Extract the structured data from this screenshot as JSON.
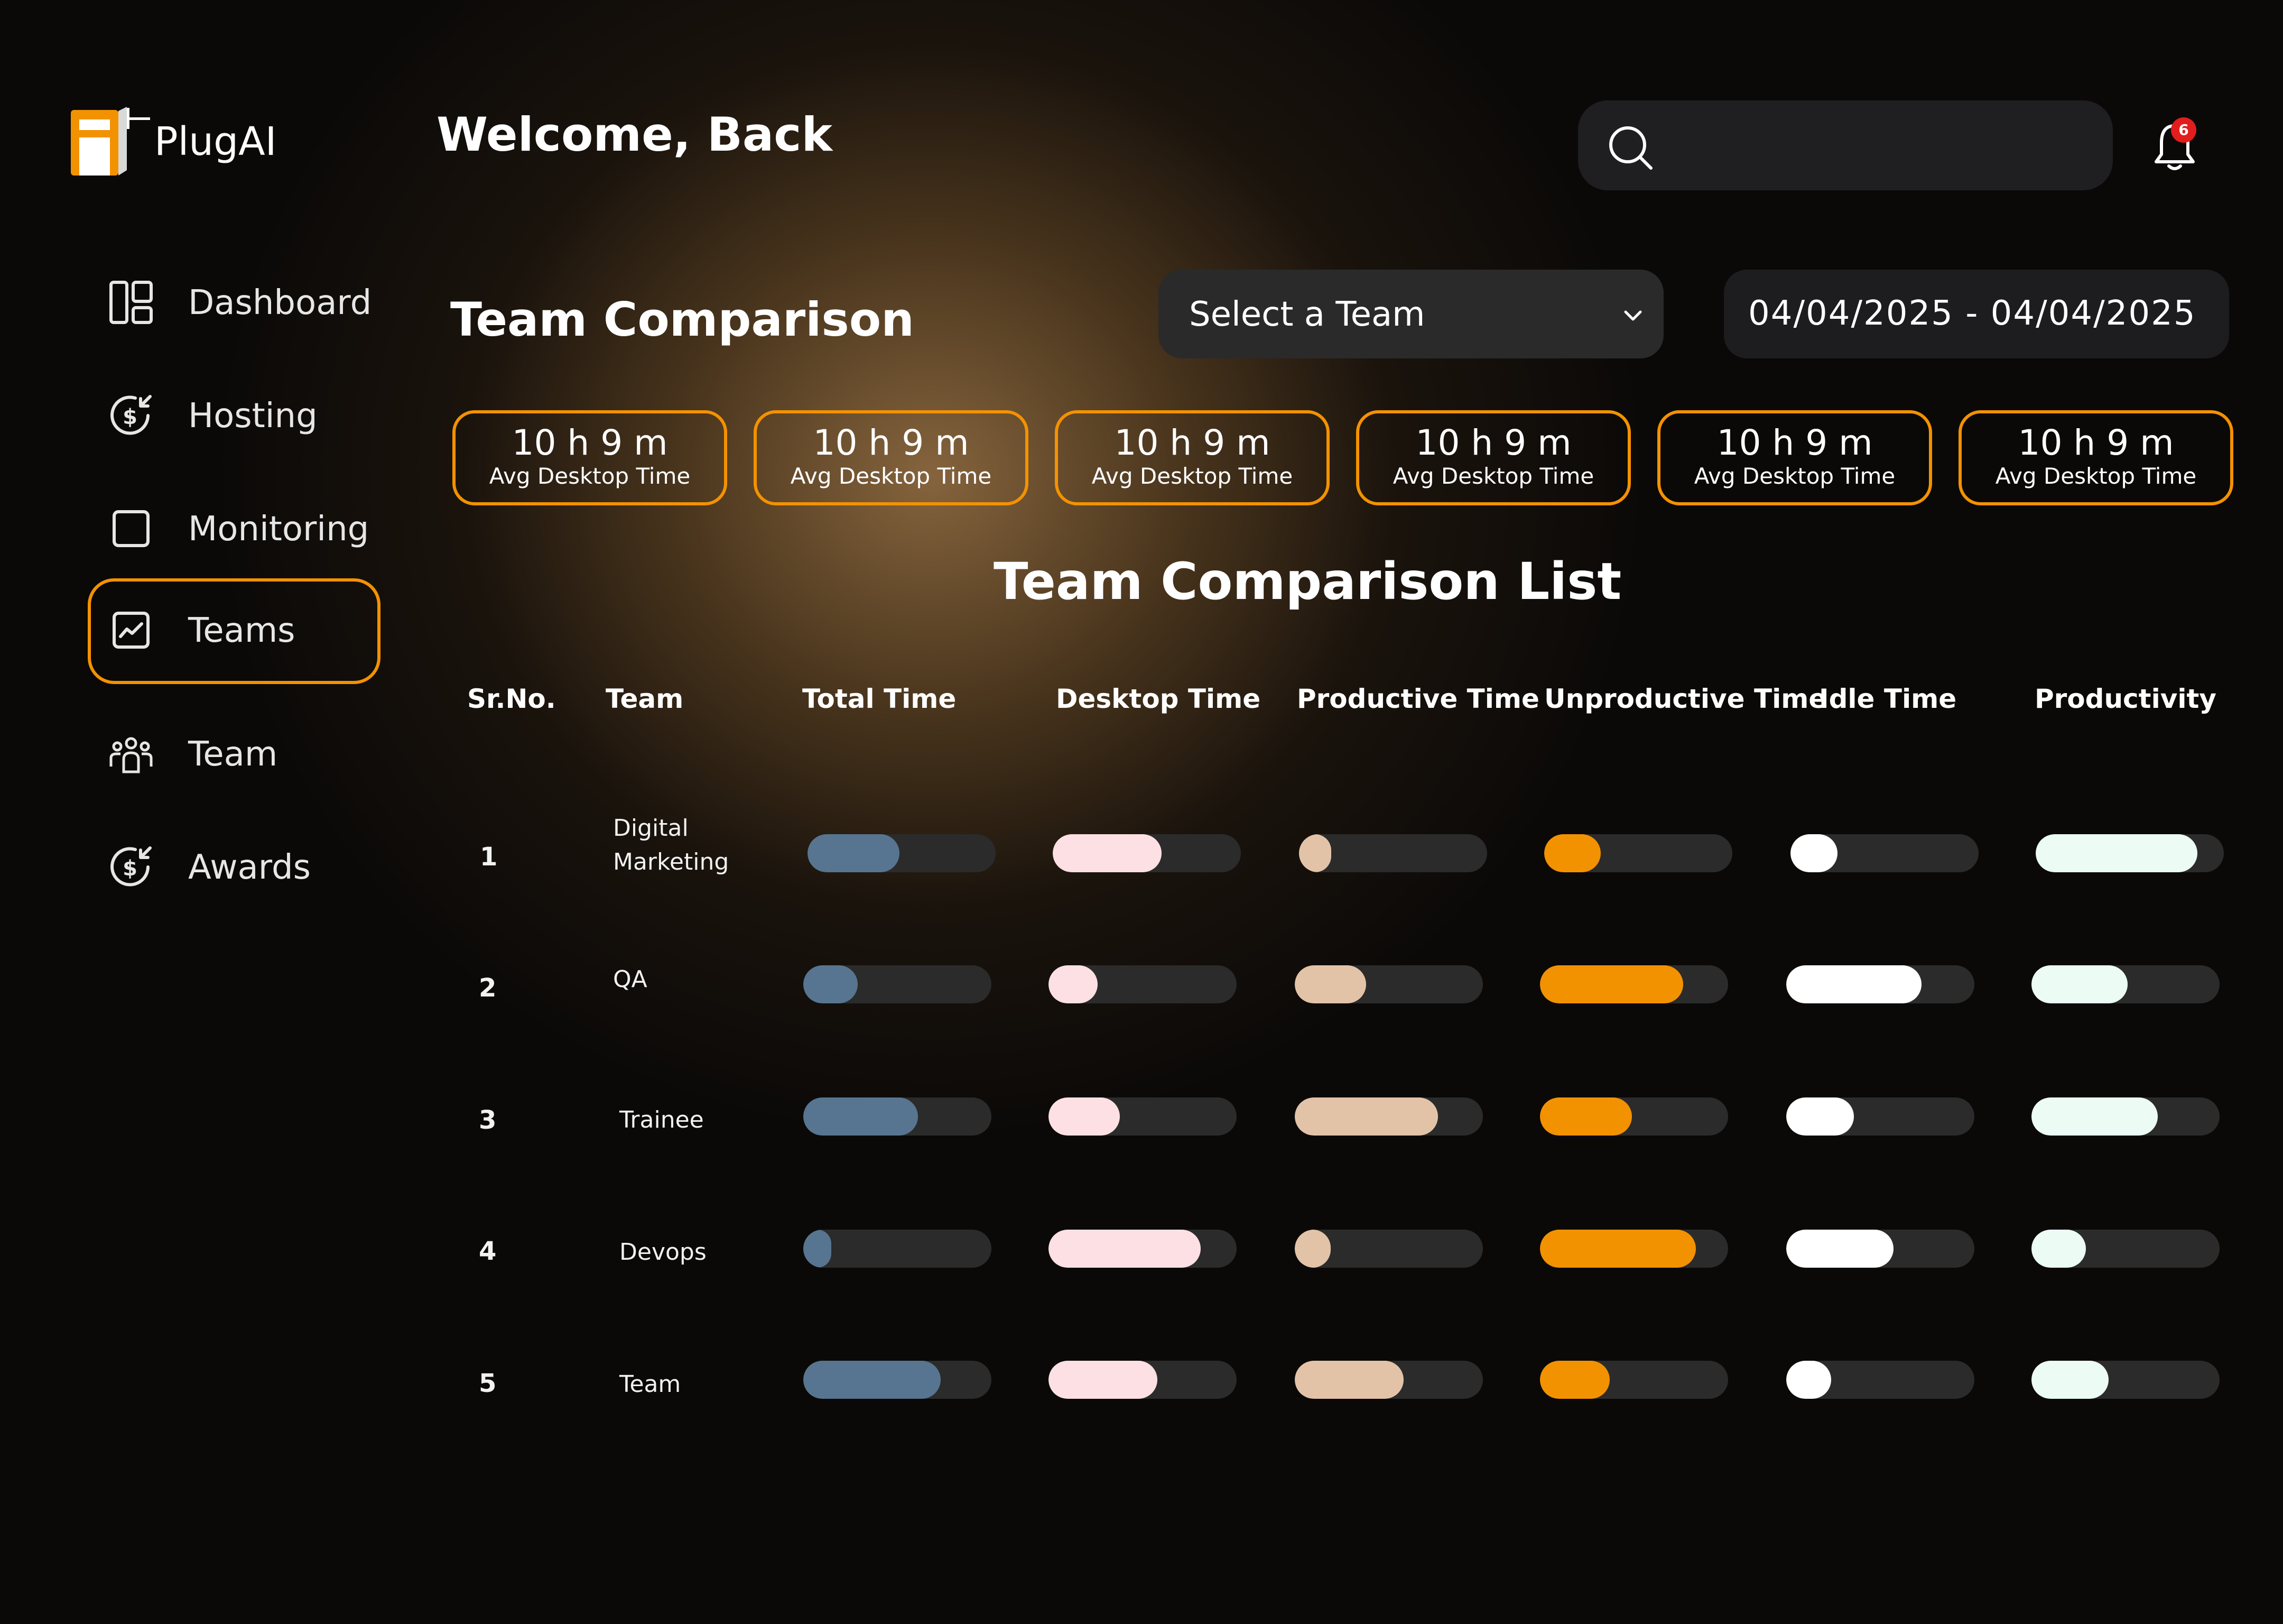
{
  "app": {
    "brand": "PlugAI",
    "welcome": "Welcome, Back",
    "search_placeholder": "Search",
    "notification_count": "6"
  },
  "colors": {
    "accent": "#f39200",
    "total_time": "#577590",
    "desktop_time": "#fde0e3",
    "productive_time": "#e3c3a8",
    "unproductive_time": "#f39200",
    "idle_time": "#ffffff",
    "productivity": "#ecfcf5"
  },
  "sidebar": {
    "items": [
      {
        "label": "Dashboard",
        "icon": "dashboard-icon",
        "active": false
      },
      {
        "label": "Hosting",
        "icon": "dollar-refund-icon",
        "active": false
      },
      {
        "label": "Monitoring",
        "icon": "square-icon",
        "active": false
      },
      {
        "label": "Teams",
        "icon": "chart-icon",
        "active": true
      },
      {
        "label": "Team",
        "icon": "users-icon",
        "active": false
      },
      {
        "label": "Awards",
        "icon": "dollar-refund-icon",
        "active": false
      }
    ]
  },
  "section": {
    "title": "Team Comparison",
    "team_select": "Select a Team",
    "date_range": "04/04/2025  -  04/04/2025"
  },
  "stats": [
    {
      "value": "10 h 9 m",
      "label": "Avg Desktop Time"
    },
    {
      "value": "10 h 9 m",
      "label": "Avg Desktop Time"
    },
    {
      "value": "10 h 9 m",
      "label": "Avg Desktop Time"
    },
    {
      "value": "10 h 9 m",
      "label": "Avg Desktop Time"
    },
    {
      "value": "10 h 9 m",
      "label": "Avg Desktop Time"
    },
    {
      "value": "10 h 9 m",
      "label": "Avg Desktop Time"
    }
  ],
  "list": {
    "title": "Team Comparison List",
    "columns": [
      "Sr.No.",
      "Team",
      "Total Time",
      "Desktop Time",
      "Productive Time",
      "Unproductive Time",
      "Idle Time",
      "Productivity"
    ],
    "rows": [
      {
        "sr": "1",
        "team": [
          "Digital",
          "Marketing"
        ],
        "values": [
          0.49,
          0.58,
          0.17,
          0.3,
          0.25,
          0.86
        ]
      },
      {
        "sr": "2",
        "team": [
          "QA"
        ],
        "values": [
          0.29,
          0.26,
          0.38,
          0.76,
          0.72,
          0.51
        ]
      },
      {
        "sr": "3",
        "team": [
          "Trainee"
        ],
        "values": [
          0.61,
          0.38,
          0.76,
          0.49,
          0.36,
          0.67
        ]
      },
      {
        "sr": "4",
        "team": [
          "Devops"
        ],
        "values": [
          0.15,
          0.81,
          0.19,
          0.83,
          0.57,
          0.29
        ]
      },
      {
        "sr": "5",
        "team": [
          "Team"
        ],
        "values": [
          0.73,
          0.58,
          0.58,
          0.37,
          0.24,
          0.41
        ]
      }
    ]
  }
}
